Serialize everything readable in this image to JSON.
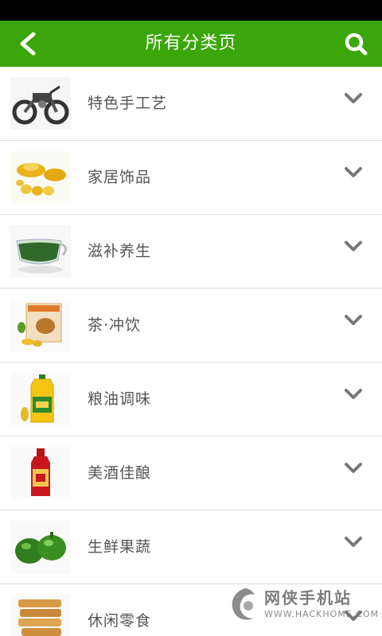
{
  "header": {
    "title": "所有分类页"
  },
  "colors": {
    "accent": "#3aa60a",
    "status_bar": "#000000"
  },
  "categories": [
    {
      "label": "特色手工艺",
      "icon": "motorcycle-craft"
    },
    {
      "label": "家居饰品",
      "icon": "gold-ingots"
    },
    {
      "label": "滋补养生",
      "icon": "green-tea-cup"
    },
    {
      "label": "茶·冲饮",
      "icon": "cereal-box"
    },
    {
      "label": "粮油调味",
      "icon": "oil-bottle"
    },
    {
      "label": "美酒佳酿",
      "icon": "liquor-bottle"
    },
    {
      "label": "生鲜果蔬",
      "icon": "green-peppers"
    },
    {
      "label": "休闲零食",
      "icon": "crackers"
    }
  ],
  "watermark": {
    "name": "网侠手机站",
    "url": "WWW.HACKHOME.COM"
  }
}
